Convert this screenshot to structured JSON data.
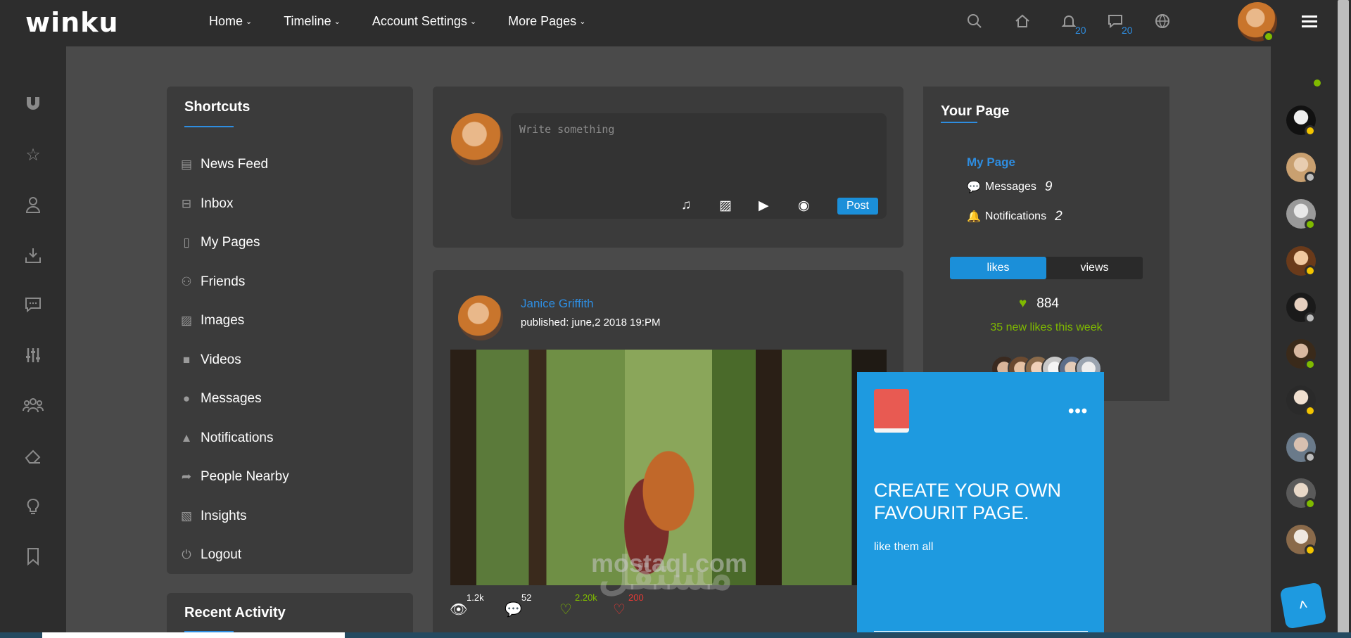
{
  "brand": {
    "logo": "winku"
  },
  "nav": {
    "items": [
      {
        "label": "Home"
      },
      {
        "label": "Timeline"
      },
      {
        "label": "Account Settings"
      },
      {
        "label": "More Pages"
      }
    ]
  },
  "topbar": {
    "notifications_count": "20",
    "messages_count": "20",
    "icons": [
      "search-icon",
      "home-icon",
      "bell-icon",
      "chat-icon",
      "globe-icon"
    ]
  },
  "shortcuts": {
    "title": "Shortcuts",
    "items": [
      {
        "label": "News Feed",
        "icon": "clipboard-icon"
      },
      {
        "label": "Inbox",
        "icon": "inbox-icon"
      },
      {
        "label": "My Pages",
        "icon": "file-icon"
      },
      {
        "label": "Friends",
        "icon": "users-icon"
      },
      {
        "label": "Images",
        "icon": "image-icon"
      },
      {
        "label": "Videos",
        "icon": "video-icon"
      },
      {
        "label": "Messages",
        "icon": "comment-icon"
      },
      {
        "label": "Notifications",
        "icon": "bell-icon"
      },
      {
        "label": "People Nearby",
        "icon": "share-icon"
      },
      {
        "label": "Insights",
        "icon": "chart-icon"
      },
      {
        "label": "Logout",
        "icon": "power-icon"
      }
    ]
  },
  "recent_activity": {
    "title": "Recent Activity"
  },
  "composer": {
    "placeholder": "Write something",
    "post_label": "Post"
  },
  "post": {
    "author": "Janice Griffith",
    "published": "published: june,2 2018 19:PM",
    "views": "1.2k",
    "comments": "52",
    "likes": "2.20k",
    "dislikes": "200"
  },
  "your_page": {
    "title": "Your Page",
    "link": "My Page",
    "messages_label": "Messages",
    "messages_count": "9",
    "notifications_label": "Notifications",
    "notifications_count": "2",
    "tab_likes": "likes",
    "tab_views": "views",
    "likes_total": "884",
    "likes_new": "35 new likes this week"
  },
  "promo": {
    "title": "CREATE YOUR OWN FAVOURIT PAGE.",
    "subtitle": "like them all",
    "more": "•••"
  },
  "watermark": {
    "latin": "mostaql.com",
    "arabic": "مستقل"
  },
  "colors": {
    "accent": "#1b8fd9",
    "online": "#7fba00",
    "away": "#f2c400",
    "offline": "#bdbdbd"
  }
}
